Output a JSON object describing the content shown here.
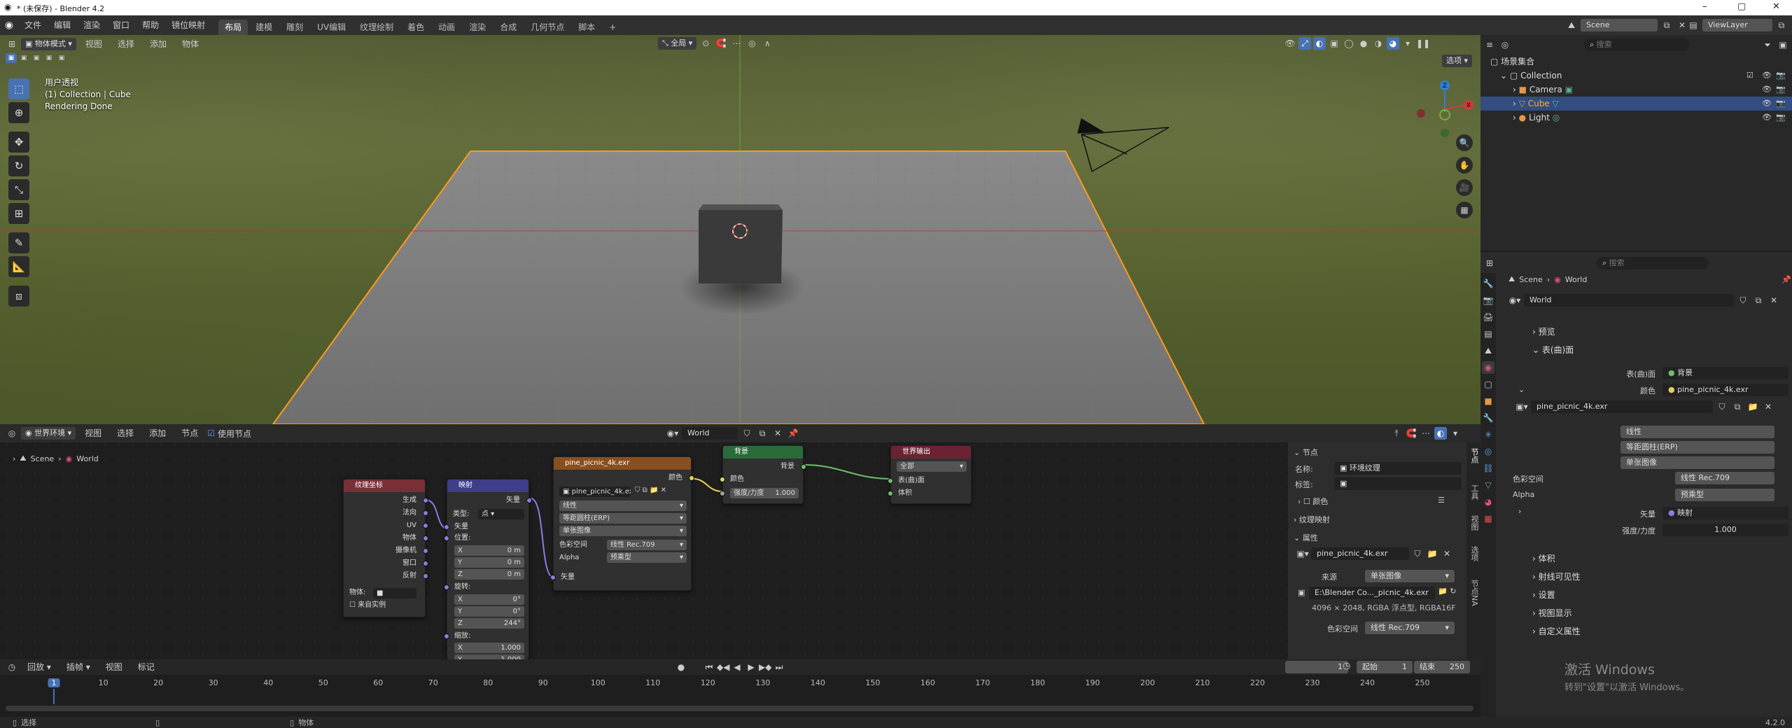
{
  "window": {
    "title": "* (未保存) - Blender 4.2",
    "controls": [
      "–",
      "▢",
      "✕"
    ]
  },
  "menu": {
    "items": [
      "文件",
      "编辑",
      "渲染",
      "窗口",
      "帮助",
      "镜位映射"
    ],
    "workspaces": [
      "布局",
      "建模",
      "雕刻",
      "UV编辑",
      "纹理绘制",
      "着色",
      "动画",
      "渲染",
      "合成",
      "几何节点",
      "脚本"
    ],
    "active_workspace": "布局",
    "add_tab": "+",
    "scene_name": "Scene",
    "view_layer": "ViewLayer"
  },
  "viewport": {
    "mode": "物体模式",
    "menus": [
      "视图",
      "选择",
      "添加",
      "物体"
    ],
    "transform_orient": "全局",
    "options": "选项",
    "overlay_lines": [
      "用户透视",
      "(1) Collection | Cube",
      "Rendering Done"
    ]
  },
  "outliner": {
    "search_placeholder": "搜索",
    "root": "场景集合",
    "collection": "Collection",
    "items": [
      {
        "name": "Camera",
        "selected": false
      },
      {
        "name": "Cube",
        "selected": true
      },
      {
        "name": "Light",
        "selected": false
      }
    ]
  },
  "properties": {
    "search_placeholder": "搜索",
    "breadcrumb": [
      "Scene",
      "World"
    ],
    "world_name": "World",
    "sections": {
      "preview": "预览",
      "surface": "表(曲)面",
      "volume": "体积",
      "ray_visibility": "射线可见性",
      "settings": "设置",
      "viewport_display": "视图显示",
      "custom_props": "自定义属性"
    },
    "surface_label": "表(曲)面",
    "surface_value": "背景",
    "color_label": "颜色",
    "color_value": "pine_picnic_4k.exr",
    "image_name": "pine_picnic_4k.exr",
    "interp": "线性",
    "projection": "等距圆柱(ERP)",
    "source": "单张图像",
    "colorspace_label": "色彩空间",
    "colorspace_value": "线性 Rec.709",
    "alpha_label": "Alpha",
    "alpha_value": "预乘型",
    "vector_label": "矢量",
    "vector_value": "映射",
    "strength_label": "强度/力度",
    "strength_value": "1.000"
  },
  "node_editor": {
    "world_type": "世界环境",
    "menus": [
      "视图",
      "选择",
      "添加",
      "节点"
    ],
    "use_nodes": "使用节点",
    "world_name": "World",
    "breadcrumb": [
      "Scene",
      "World"
    ],
    "tex_coord": {
      "title": "纹理坐标",
      "outputs": [
        "生成",
        "法向",
        "UV",
        "物体",
        "摄像机",
        "窗口",
        "反射"
      ],
      "object_label": "物体:",
      "from_instancer": "来自实例"
    },
    "mapping": {
      "title": "映射",
      "output": "矢量",
      "type_label": "类型:",
      "type_value": "点",
      "input": "矢量",
      "location": "位置:",
      "rotation": "旋转:",
      "scale": "缩放:",
      "loc": [
        {
          "axis": "X",
          "value": "0 m"
        },
        {
          "axis": "Y",
          "value": "0 m"
        },
        {
          "axis": "Z",
          "value": "0 m"
        }
      ],
      "rot": [
        {
          "axis": "X",
          "value": "0°"
        },
        {
          "axis": "Y",
          "value": "0°"
        },
        {
          "axis": "Z",
          "value": "244°"
        }
      ],
      "scl": [
        {
          "axis": "X",
          "value": "1.000"
        },
        {
          "axis": "Y",
          "value": "1.000"
        }
      ]
    },
    "env_tex": {
      "title": "pine_picnic_4k.exr",
      "output": "颜色",
      "image": "pine_picnic_4k.exr",
      "interp": "线性",
      "proj": "等距圆柱(ERP)",
      "source": "单张图像",
      "cs_label": "色彩空间",
      "cs_value": "线性 Rec.709",
      "alpha_label": "Alpha",
      "alpha_value": "预乘型",
      "input": "矢量"
    },
    "background": {
      "title": "背景",
      "output": "背景",
      "color": "颜色",
      "strength_label": "强度/力度",
      "strength_value": "1.000"
    },
    "world_output": {
      "title": "世界输出",
      "target": "全部",
      "surface": "表(曲)面",
      "volume": "体积"
    }
  },
  "n_panel": {
    "node_section": "节点",
    "name_label": "名称:",
    "name_value": "环境纹理",
    "label_label": "标签:",
    "color": "颜色",
    "tex_mapping": "纹理映射",
    "attributes": "属性",
    "image_name": "pine_picnic_4k.exr",
    "source_label": "来源",
    "source_value": "单张图像",
    "filepath": "E:\\Blender Co..._picnic_4k.exr",
    "info": "4096 × 2048, RGBA 浮点型, RGBA16F",
    "cs_label": "色彩空间",
    "cs_value": "线性 Rec.709",
    "tabs": [
      "节点",
      "工具",
      "视图",
      "选项",
      "节点NA"
    ]
  },
  "timeline": {
    "menus": [
      "回放",
      "插帧",
      "视图",
      "标记"
    ],
    "current_frame": "1",
    "start_label": "起始",
    "start": "1",
    "end_label": "结束",
    "end": "250",
    "ticks": [
      "1",
      "10",
      "20",
      "30",
      "40",
      "50",
      "60",
      "70",
      "80",
      "90",
      "100",
      "110",
      "120",
      "130",
      "140",
      "150",
      "160",
      "170",
      "180",
      "190",
      "200",
      "210",
      "220",
      "230",
      "240",
      "250"
    ]
  },
  "status": {
    "left": "选择",
    "mid": "物体",
    "version": "4.2.0"
  },
  "watermark": {
    "line1": "激活 Windows",
    "line2": "转到\"设置\"以激活 Windows。"
  }
}
